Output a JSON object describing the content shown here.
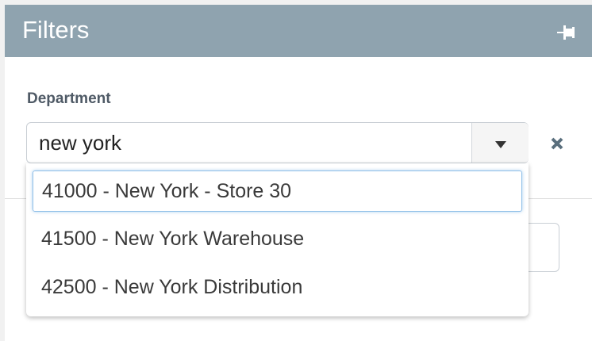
{
  "header": {
    "title": "Filters",
    "pin_icon": "pin-icon"
  },
  "department_field": {
    "label": "Department",
    "input_value": "new york",
    "toggle_icon": "caret-down-icon",
    "clear_icon": "close-icon"
  },
  "dropdown": {
    "options": [
      {
        "label": "41000 - New York - Store 30",
        "highlighted": true
      },
      {
        "label": "41500 - New York Warehouse",
        "highlighted": false
      },
      {
        "label": "42500 - New York Distribution",
        "highlighted": false
      }
    ]
  },
  "colors": {
    "header_bg": "#8fa3af",
    "highlight_border": "#8fbfe8"
  }
}
